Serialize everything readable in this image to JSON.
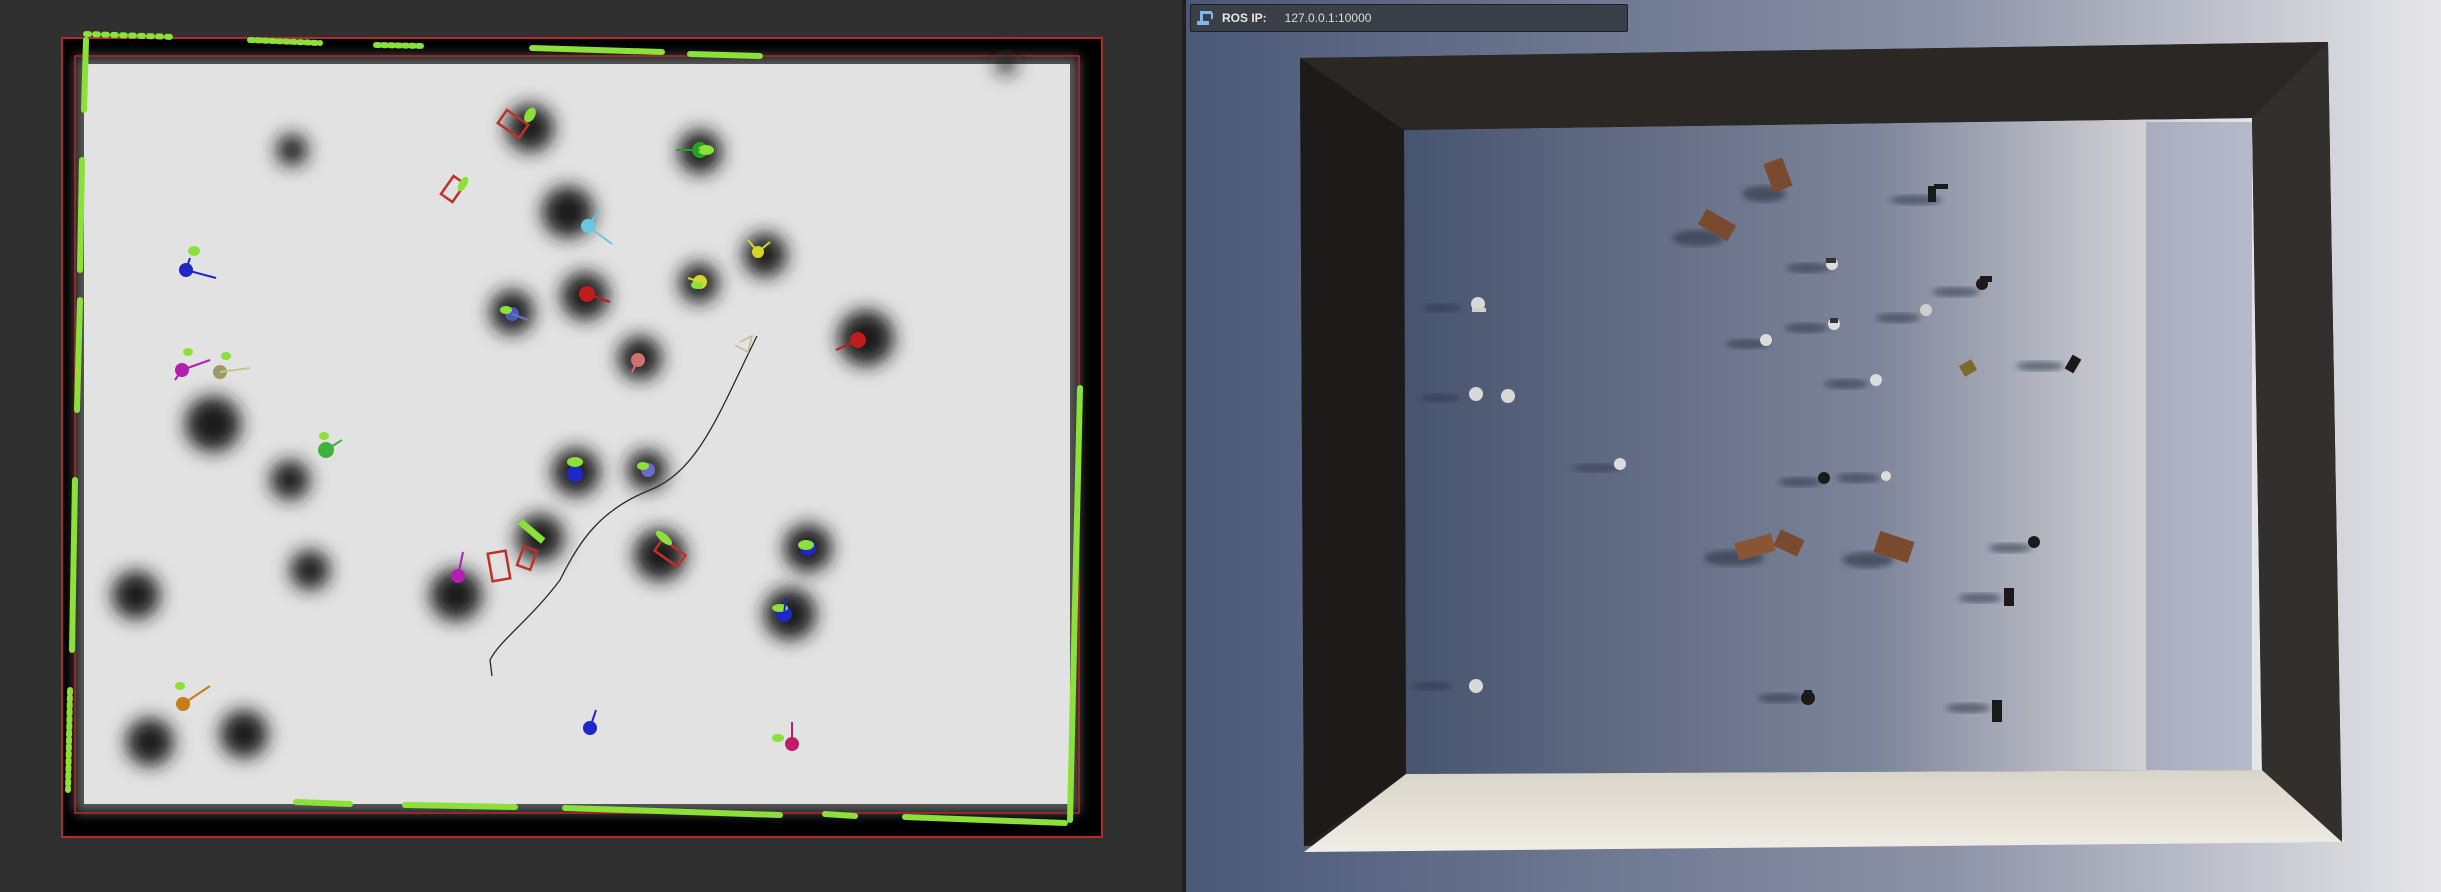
{
  "ros_bar": {
    "label": "ROS IP:",
    "value": "127.0.0.1:10000",
    "icon": "robot-arm-icon"
  },
  "colors": {
    "map_background": "#e2e2e2",
    "map_border": "#b22a2a",
    "laser_scan": "#8be03a",
    "obstacle": "#1c1c1c",
    "path": "#2a2a2a"
  }
}
